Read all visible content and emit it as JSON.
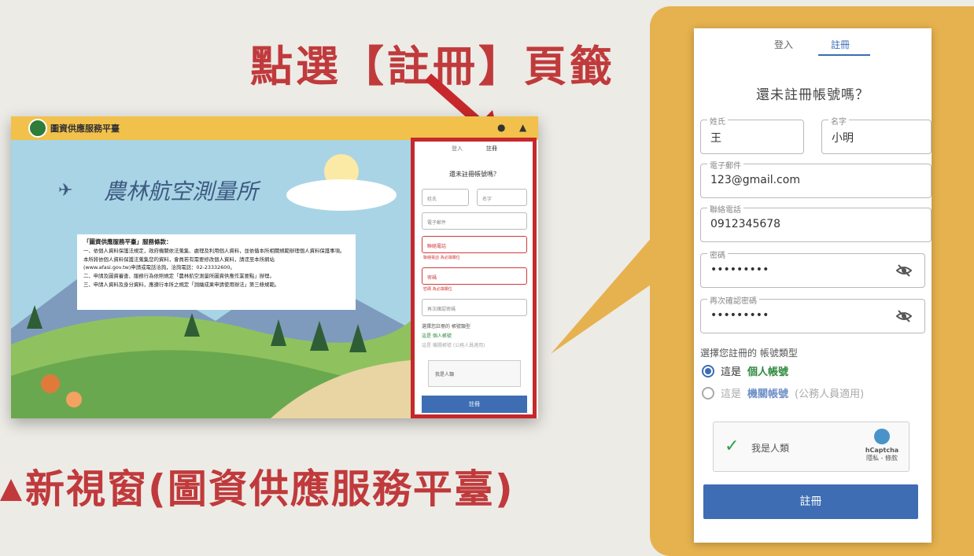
{
  "headline": "點選【註冊】頁籤",
  "bottom_caption": "新視窗(圖資供應服務平臺)",
  "screenshot": {
    "platform_title": "圖資供應服務平臺",
    "brand_text": "農林航空測量所",
    "notice": {
      "title": "「圖資供應服務平臺」服務條款：",
      "lines": [
        "一、依個人資料保護法規定，政府機關依法蒐集、處理及利用個人資料，並依循本所相關規範辦理個人資料保護事項。",
        "本所將依個人資料保護法蒐集您的資料，會員若有需要修改個人資料，請逕至本所網站",
        "(www.afasi.gov.tw)申請或電話洽詢，洽詢電話：02-23332600。",
        "二、申請及圖資審查、服務行為依照規定「農林航空測量所圖資供應作業要點」辦理。",
        "三、申請人資料及身分資料，應遵行本所之規定「測繪成果申請使用辦法」第三條規範。"
      ]
    },
    "mini_form": {
      "tabs": [
        "登入",
        "註冊"
      ],
      "question": "還未註冊帳號嗎？",
      "surname": "姓氏",
      "given": "名字",
      "email": "電子郵件",
      "phone": "聯絡電話",
      "phone_err": "聯絡電話 為必填欄位",
      "password": "密碼",
      "password_err": "密碼 為必填欄位",
      "confirm": "再次確認密碼",
      "acct_type": "選擇您註冊的 帳號類型",
      "opt1": "這是 個人帳號",
      "opt2": "這是 機關帳號 (公務人員適用)",
      "captcha": "我是人類",
      "submit": "註冊"
    }
  },
  "form": {
    "tabs": {
      "login": "登入",
      "register": "註冊"
    },
    "question": "還未註冊帳號嗎？",
    "surname": {
      "label": "姓氏",
      "value": "王"
    },
    "given_name": {
      "label": "名字",
      "value": "小明"
    },
    "email": {
      "label": "電子郵件",
      "value": "123@gmail.com"
    },
    "phone": {
      "label": "聯絡電話",
      "value": "0912345678"
    },
    "password": {
      "label": "密碼",
      "value": "•••••••••"
    },
    "confirm_password": {
      "label": "再次確認密碼",
      "value": "•••••••••"
    },
    "account_type_label": "選擇您註冊的 帳號類型",
    "option_personal": {
      "prefix": "這是",
      "highlight": "個人帳號"
    },
    "option_agency": {
      "prefix": "這是",
      "highlight": "機關帳號",
      "suffix": "(公務人員適用)"
    },
    "captcha": {
      "text": "我是人類",
      "brand": "hCaptcha",
      "links": "隱私 - 條款"
    },
    "submit_label": "註冊"
  },
  "colors": {
    "accent_red": "#c03a3c",
    "callout_gold": "#e6b24f",
    "button_blue": "#3e6db3"
  }
}
